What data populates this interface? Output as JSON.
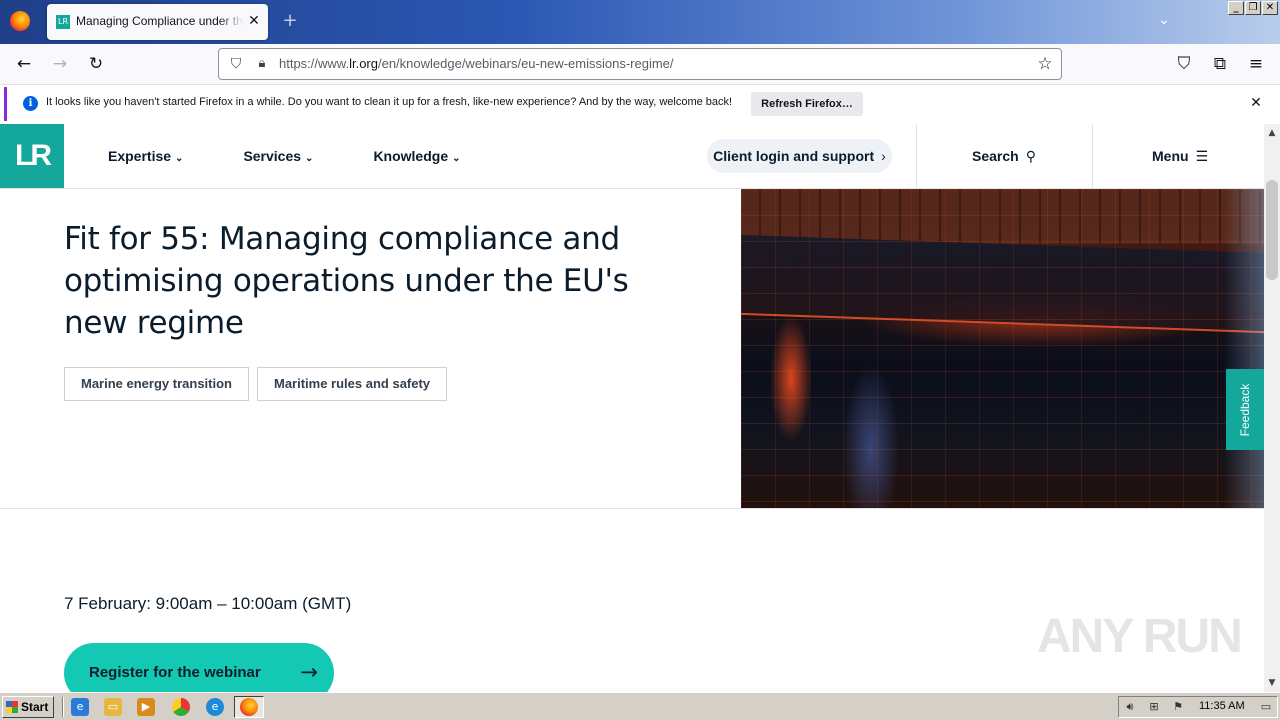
{
  "browser": {
    "tab": {
      "title": "Managing Compliance under the EU new emissions regime",
      "favicon_text": "LR"
    },
    "url": {
      "prefix": "https://www.",
      "domain": "lr.org",
      "path": "/en/knowledge/webinars/eu-new-emissions-regime/"
    },
    "notification": {
      "message": "It looks like you haven't started Firefox in a while. Do you want to clean it up for a fresh, like-new experience? And by the way, welcome back!",
      "button": "Refresh Firefox…"
    },
    "window_buttons": [
      "_",
      "❐",
      "✕"
    ]
  },
  "site": {
    "logo": "LR",
    "nav": [
      {
        "label": "Expertise"
      },
      {
        "label": "Services"
      },
      {
        "label": "Knowledge"
      }
    ],
    "client_login": "Client login and support",
    "search": "Search",
    "menu": "Menu",
    "feedback": "Feedback"
  },
  "hero": {
    "title": "Fit for 55: Managing compliance and optimising operations under the EU's new regime",
    "tags": [
      "Marine energy transition",
      "Maritime rules and safety"
    ]
  },
  "event": {
    "date": "7 February: 9:00am – 10:00am (GMT)",
    "register": "Register for the webinar"
  },
  "watermark": "ANY RUN",
  "taskbar": {
    "start": "Start",
    "clock": "11:35 AM"
  },
  "colors": {
    "brand_teal": "#14a79b",
    "cta_teal": "#14c9b4",
    "text_dark": "#0b1d2c"
  }
}
